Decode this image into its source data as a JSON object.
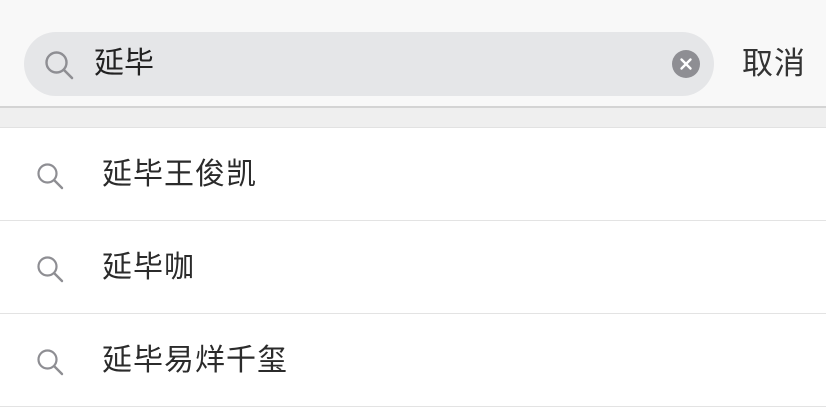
{
  "search": {
    "query": "延毕",
    "cancel_label": "取消",
    "icon": "search-icon",
    "clear_icon": "clear-icon"
  },
  "suggestions": [
    {
      "label": "延毕王俊凯",
      "icon": "search-icon"
    },
    {
      "label": "延毕咖",
      "icon": "search-icon"
    },
    {
      "label": "延毕易烊千玺",
      "icon": "search-icon"
    }
  ],
  "colors": {
    "header_background": "#f8f8f8",
    "search_box": "#e5e6e8",
    "clear_button": "#8e8e93",
    "icon_gray": "#8e8e93",
    "text": "#2b2b2b"
  }
}
